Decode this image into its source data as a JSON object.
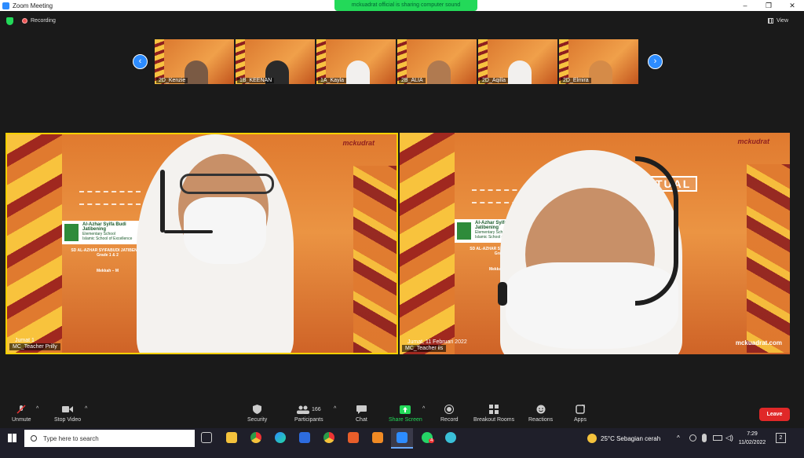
{
  "window": {
    "title": "Zoom Meeting",
    "minimize": "–",
    "maximize": "❐",
    "close": "✕"
  },
  "share_banner": "mckuadrat official is sharing computer sound",
  "meeting_bar": {
    "recording": "Recording",
    "view": "View"
  },
  "thumbnails": [
    {
      "name": "2D_Kenzie",
      "person_color": "#7a5a44"
    },
    {
      "name": "1B_KEENAN",
      "person_color": "#2a2a2a"
    },
    {
      "name": "1A_Kayla",
      "person_color": "#f2f0ee"
    },
    {
      "name": "2B_ALIA",
      "person_color": "#b07a50"
    },
    {
      "name": "2D_Aqilla",
      "person_color": "#f2f0ee"
    },
    {
      "name": "2D_Elmira",
      "person_color": "#d58b48"
    }
  ],
  "nav": {
    "prev": "‹",
    "next": "›"
  },
  "videos": [
    {
      "name": "MC_Teacher Prilly",
      "brand": "mckudrat",
      "logo_title": "Al-Azhar Syifa Budi Jatibening",
      "logo_sub": "Elementary School",
      "logo_tag": "Islamic School of Excellence",
      "school": "SD AL-AZHAR SYIFABUDI JATIBENING",
      "grade": "Grade 1 & 2",
      "place": "Mekkah – M",
      "date": "Jumat 1"
    },
    {
      "name": "MC_Teacher iis",
      "brand": "mckudrat",
      "logo_title": "Al-Azhar Syifa Budi Jatibening",
      "logo_sub": "Elementary School",
      "logo_tag": "Islamic School of Excellence",
      "school": "SD AL-AZHAR SYIFABUDI JATIB",
      "grade": "Grade",
      "place": "Mekkah – M",
      "date": "Jumat, 11 Februari 2022",
      "url": "mckuadrat.com",
      "banner_word": "TUAL"
    }
  ],
  "toolbar": {
    "unmute": "Unmute",
    "stop_video": "Stop Video",
    "security": "Security",
    "participants": "Participants",
    "participants_count": "166",
    "chat": "Chat",
    "share_screen": "Share Screen",
    "record": "Record",
    "breakout_rooms": "Breakout Rooms",
    "reactions": "Reactions",
    "apps": "Apps",
    "leave": "Leave"
  },
  "taskbar": {
    "search_placeholder": "Type here to search",
    "weather": "25°C  Sebagian cerah",
    "time": "7:29",
    "date": "11/02/2022",
    "notifications": "2",
    "whatsapp_badge": "4"
  }
}
